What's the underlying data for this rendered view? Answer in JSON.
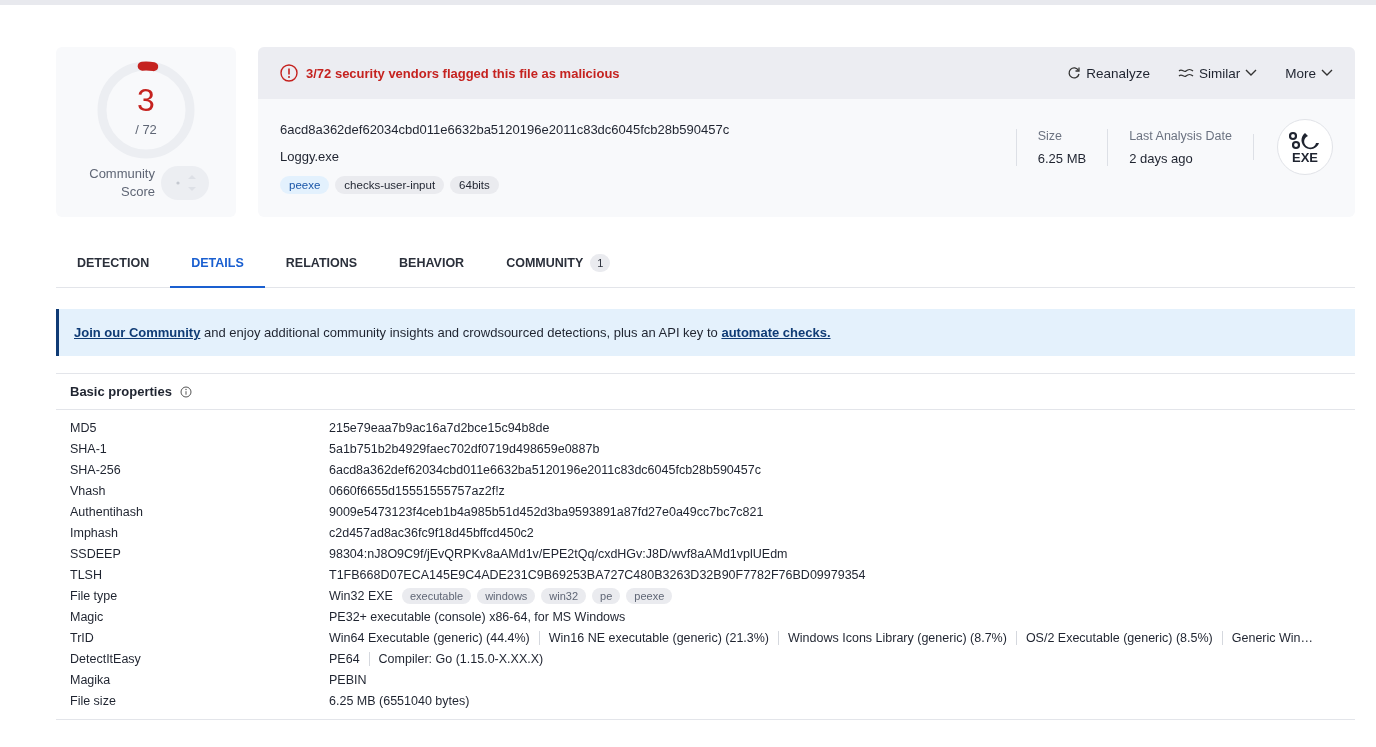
{
  "score": {
    "value": "3",
    "total": "/ 72",
    "level": 0.042,
    "label": "Community Score"
  },
  "alert": {
    "text": "3/72 security vendors flagged this file as malicious"
  },
  "actions": [
    {
      "kind": "reanalyze",
      "label": "Reanalyze"
    },
    {
      "kind": "similar",
      "label": "Similar"
    },
    {
      "kind": "more",
      "label": "More"
    }
  ],
  "file": {
    "hash": "6acd8a362def62034cbd011e6632ba5120196e2011c83dc6045fcb28b590457c",
    "name": "Loggy.exe",
    "tags": [
      {
        "label": "peexe",
        "highlighted": true
      },
      {
        "label": "checks-user-input",
        "highlighted": false
      },
      {
        "label": "64bits",
        "highlighted": false
      }
    ],
    "stats": [
      {
        "label": "Size",
        "value": "6.25 MB"
      },
      {
        "label": "Last Analysis Date",
        "value": "2 days ago"
      }
    ],
    "type_badge": "EXE"
  },
  "tabs": [
    {
      "label": "DETECTION",
      "selected": false
    },
    {
      "label": "DETAILS",
      "selected": true
    },
    {
      "label": "RELATIONS",
      "selected": false
    },
    {
      "label": "BEHAVIOR",
      "selected": false
    },
    {
      "label": "COMMUNITY",
      "selected": false,
      "count": "1"
    }
  ],
  "banner": [
    {
      "kind": "link",
      "text": "Join our Community"
    },
    {
      "kind": "text",
      "text": " and enjoy additional community insights and crowdsourced detections, plus an API key to "
    },
    {
      "kind": "link",
      "text": "automate checks."
    }
  ],
  "section": {
    "title": "Basic properties",
    "rows": [
      {
        "label": "MD5",
        "values": [
          "215e79eaa7b9ac16a7d2bce15c94b8de"
        ]
      },
      {
        "label": "SHA-1",
        "values": [
          "5a1b751b2b4929faec702df0719d498659e0887b"
        ]
      },
      {
        "label": "SHA-256",
        "values": [
          "6acd8a362def62034cbd011e6632ba5120196e2011c83dc6045fcb28b590457c"
        ]
      },
      {
        "label": "Vhash",
        "values": [
          "0660f6655d15551555757az2f!z"
        ]
      },
      {
        "label": "Authentihash",
        "values": [
          "9009e5473123f4ceb1b4a985b51d452d3ba9593891a87fd27e0a49cc7bc7c821"
        ]
      },
      {
        "label": "Imphash",
        "values": [
          "c2d457ad8ac36fc9f18d45bffcd450c2"
        ]
      },
      {
        "label": "SSDEEP",
        "values": [
          "98304:nJ8O9C9f/jEvQRPKv8aAMd1v/EPE2tQq/cxdHGv:J8D/wvf8aAMd1vplUEdm"
        ]
      },
      {
        "label": "TLSH",
        "values": [
          "T1FB668D07ECA145E9C4ADE231C9B69253BA727C480B3263D32B90F7782F76BD09979354"
        ]
      },
      {
        "label": "File type",
        "values": [
          "Win32 EXE"
        ],
        "tags": [
          "executable",
          "windows",
          "win32",
          "pe",
          "peexe"
        ]
      },
      {
        "label": "Magic",
        "values": [
          "PE32+ executable (console) x86-64, for MS Windows"
        ]
      },
      {
        "label": "TrID",
        "values": [
          "Win64 Executable (generic) (44.4%)",
          "Win16 NE executable (generic) (21.3%)",
          "Windows Icons Library (generic) (8.7%)",
          "OS/2 Executable (generic) (8.5%)",
          "Generic Win…"
        ]
      },
      {
        "label": "DetectItEasy",
        "values": [
          "PE64",
          "Compiler: Go (1.15.0-X.XX.X)"
        ]
      },
      {
        "label": "Magika",
        "values": [
          "PEBIN"
        ]
      },
      {
        "label": "File size",
        "values": [
          "6.25 MB (6551040 bytes)"
        ]
      }
    ]
  }
}
